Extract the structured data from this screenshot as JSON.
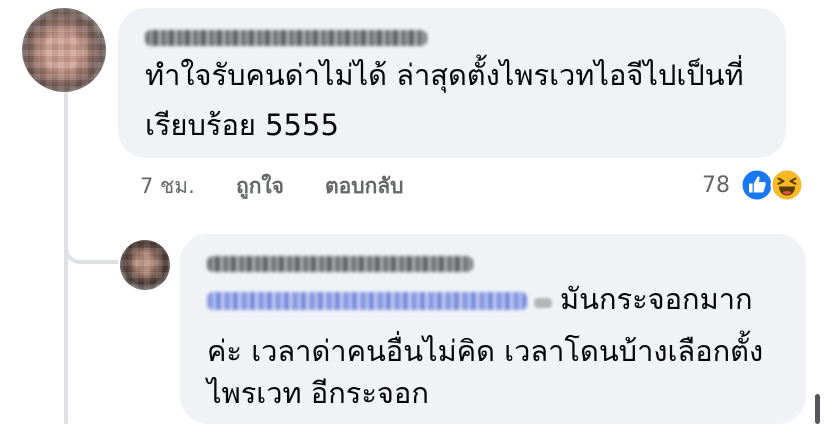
{
  "comment": {
    "author": "",
    "text_lines": [
      "ทำใจรับคนด่าไม่ได้ ล่าสุดตั้งไพรเวทไอจีไปเป็นที่",
      "เรียบร้อย 5555"
    ],
    "time": "7 ชม.",
    "like_label": "ถูกใจ",
    "reply_label": "ตอบกลับ",
    "reaction_count": "78",
    "reactions": [
      "like-icon",
      "haha-icon"
    ],
    "colors": {
      "like": "#1877f2",
      "haha": "#f7b928",
      "bubble": "#f0f2f5",
      "meta": "#65676b"
    }
  },
  "reply": {
    "author": "",
    "mention": "",
    "text_lines": [
      "มันกระจอกมาก",
      "ค่ะ เวลาด่าคนอื่นไม่คิด เวลาโดนบ้างเลือกตั้ง",
      "ไพรเวท อีกระจอก"
    ]
  }
}
